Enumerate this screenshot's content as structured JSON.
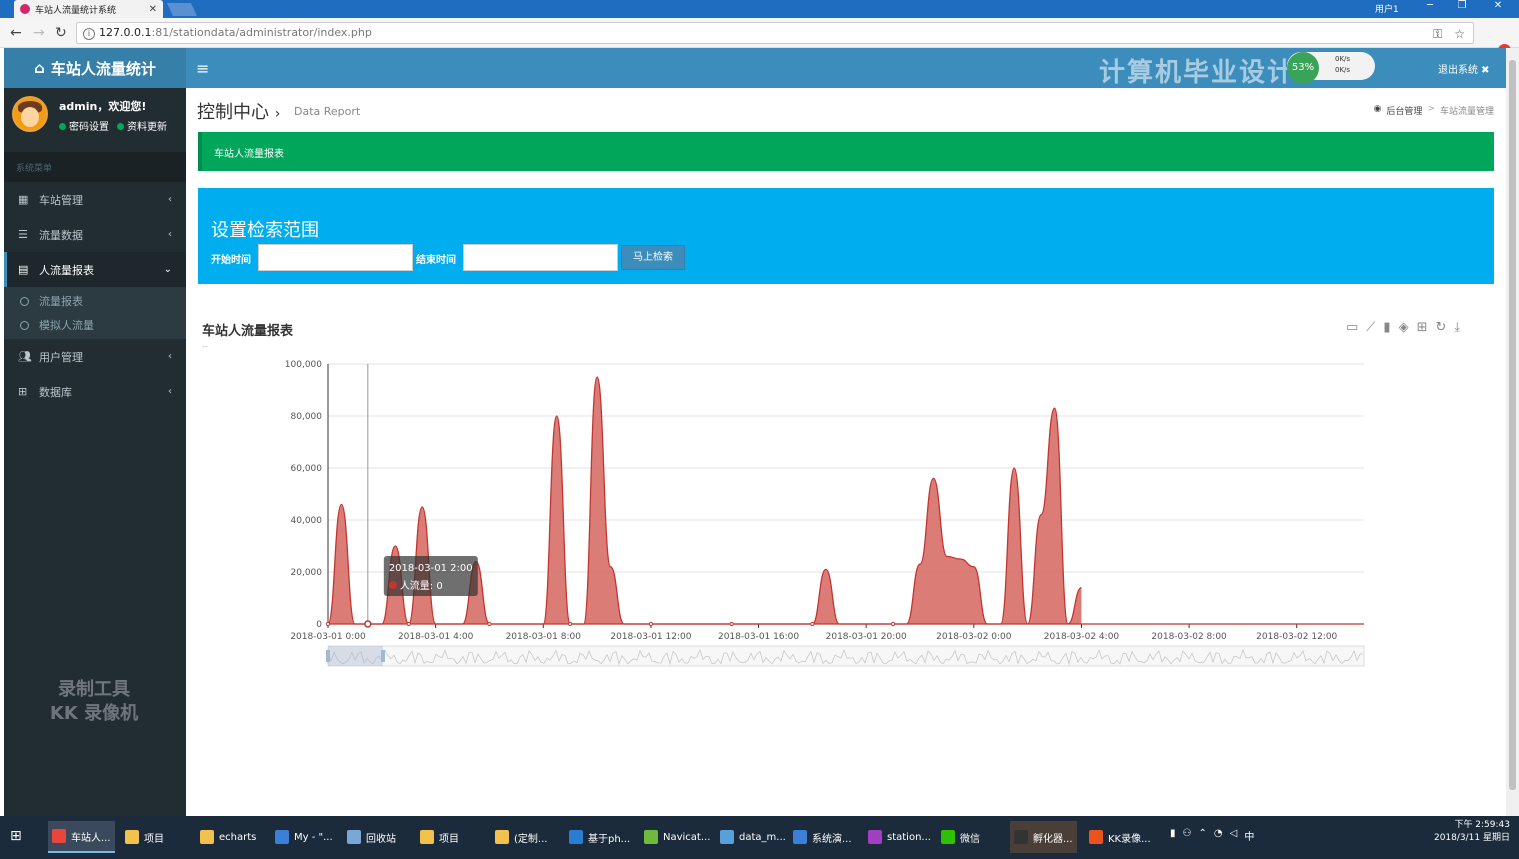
{
  "browser": {
    "tab_title": "车站人流量统计系统",
    "tab_close": "✕",
    "profile_name": "用户1",
    "url_host": "127.0.0.1",
    "url_path": ":81/stationdata/administrator/index.php"
  },
  "header": {
    "logo_icon": "home-icon",
    "logo_text": "车站人流量统计",
    "menu_icon": "≡",
    "watermark": "计算机毕业设计",
    "net_percent": "53%",
    "net_up": "0K/s",
    "net_down": "0K/s",
    "logout_label": "退出系统 ✖"
  },
  "sidebar": {
    "user_name": "admin，欢迎您!",
    "link_password": "密码设置",
    "link_profile": "资料更新",
    "section_header": "系统菜单",
    "items": [
      {
        "label": "车站管理",
        "icon": "grid-icon"
      },
      {
        "label": "流量数据",
        "icon": "list-icon"
      },
      {
        "label": "人流量报表",
        "icon": "file-icon"
      },
      {
        "label": "用户管理",
        "icon": "users-icon"
      },
      {
        "label": "数据库",
        "icon": "table-icon"
      }
    ],
    "sub_items": [
      {
        "label": "流量报表"
      },
      {
        "label": "模拟人流量"
      }
    ],
    "recording_watermark_1": "录制工具",
    "recording_watermark_2": "KK 录像机"
  },
  "content": {
    "title": "控制中心",
    "subtitle": "Data Report",
    "breadcrumb": [
      "后台管理",
      "车站流量管理"
    ],
    "green_bar_text": "车站人流量报表",
    "search": {
      "title": "设置检索范围",
      "start_label": "开始时间",
      "end_label": "结束时间",
      "start_value": "",
      "end_value": "",
      "button_label": "马上检索"
    },
    "chart_title": "车站人流量报表",
    "chart_subtitle": "--"
  },
  "chart_data": {
    "type": "area",
    "title": "车站人流量报表",
    "series": [
      {
        "name": "人流量",
        "color": "#c23531"
      }
    ],
    "ylim": [
      0,
      100000
    ],
    "yticks": [
      0,
      20000,
      40000,
      60000,
      80000,
      100000
    ],
    "ytick_labels": [
      "0",
      "20,000",
      "40,000",
      "60,000",
      "80,000",
      "100,000"
    ],
    "xtick_labels": [
      "2018-03-01 0:00",
      "2018-03-01 4:00",
      "2018-03-01 8:00",
      "2018-03-01 12:00",
      "2018-03-01 16:00",
      "2018-03-01 20:00",
      "2018-03-02 0:00",
      "2018-03-02 4:00",
      "2018-03-02 8:00",
      "2018-03-02 12:00"
    ],
    "x_hours": [
      0,
      0.5,
      1,
      1.5,
      2,
      2.5,
      3,
      3.5,
      4,
      4.5,
      5,
      5.5,
      6,
      6.5,
      7,
      7.5,
      8,
      8.5,
      9,
      9.5,
      10,
      10.5,
      11,
      11.5,
      12,
      12.5,
      13,
      13.5,
      14,
      14.5,
      15,
      15.5,
      16,
      16.5,
      17,
      17.5,
      18,
      18.5,
      19,
      19.5,
      20,
      20.5,
      21,
      21.5,
      22,
      22.5,
      23,
      23.5,
      24,
      24.5,
      25,
      25.5,
      26,
      26.5,
      27,
      27.5,
      28,
      28.5,
      29,
      29.5,
      30,
      30.5,
      31,
      31.5,
      32,
      32.5,
      33,
      33.5,
      34,
      34.5,
      35,
      35.5,
      36,
      36.5,
      37,
      37.5,
      38,
      38.5,
      39
    ],
    "values": [
      0,
      46000,
      0,
      0,
      0,
      30000,
      0,
      45000,
      0,
      0,
      0,
      24000,
      0,
      0,
      0,
      0,
      0,
      80000,
      0,
      0,
      95000,
      22000,
      0,
      0,
      0,
      0,
      0,
      0,
      0,
      0,
      0,
      0,
      0,
      0,
      0,
      0,
      0,
      21000,
      0,
      0,
      0,
      0,
      0,
      0,
      23000,
      56000,
      26000,
      25000,
      22000,
      0,
      0,
      60000,
      0,
      42000,
      83000,
      0,
      14000
    ],
    "tooltip": {
      "time": "2018-03-01 2:00",
      "series": "人流量",
      "value": 0
    },
    "toolbox_icons": [
      "data-view-icon",
      "line-chart-icon",
      "bar-chart-icon",
      "stack-icon",
      "tiled-icon",
      "restore-icon",
      "save-image-icon"
    ]
  },
  "taskbar": {
    "items": [
      {
        "label": "车站人...",
        "color": "#e8453c"
      },
      {
        "label": "项目",
        "color": "#f2c14e"
      },
      {
        "label": "echarts",
        "color": "#f2c14e"
      },
      {
        "label": "My - \"...",
        "color": "#3b7fd9"
      },
      {
        "label": "回收站",
        "color": "#7ba7d6"
      },
      {
        "label": "项目",
        "color": "#f2c14e"
      },
      {
        "label": "(定制...",
        "color": "#f2c14e"
      },
      {
        "label": "基于ph...",
        "color": "#2b7cd3"
      },
      {
        "label": "Navicat...",
        "color": "#6dbb3c"
      },
      {
        "label": "data_m...",
        "color": "#5aa0d8"
      },
      {
        "label": "系统演...",
        "color": "#3b7fd9"
      },
      {
        "label": "station...",
        "color": "#a040c0"
      },
      {
        "label": "微信",
        "color": "#2dc100"
      },
      {
        "label": "孵化器...",
        "color": "#333333"
      },
      {
        "label": "KK录像...",
        "color": "#e8531e"
      }
    ],
    "ime": "中",
    "time": "下午 2:59:43",
    "date": "2018/3/11 星期日"
  }
}
